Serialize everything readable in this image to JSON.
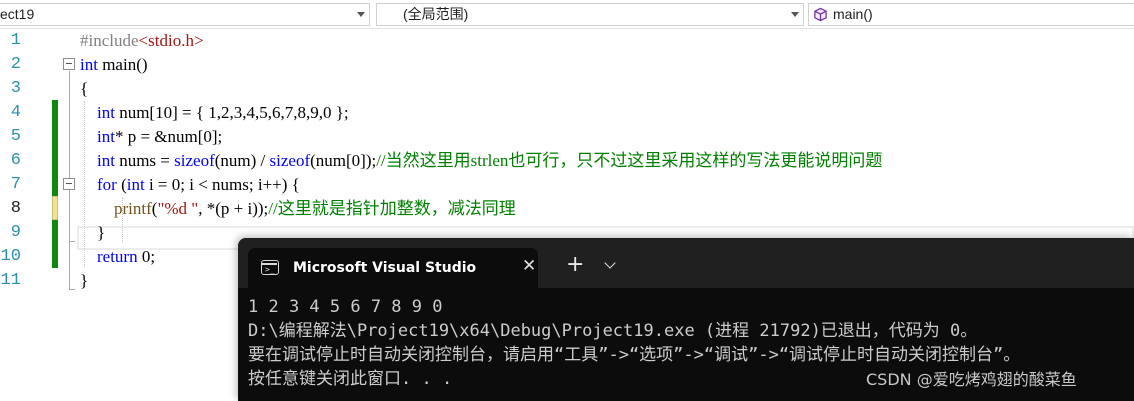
{
  "navbar": {
    "project": "ect19",
    "scope": "(全局范围)",
    "member": "main()",
    "member_icon": "cube-icon"
  },
  "editor": {
    "line_numbers": [
      "1",
      "2",
      "3",
      "4",
      "5",
      "6",
      "7",
      "8",
      "9",
      "10",
      "11"
    ],
    "current_line": "8",
    "lines": [
      [
        {
          "t": "#include",
          "c": "pp"
        },
        {
          "t": "<stdio.h>",
          "c": "str"
        }
      ],
      [
        {
          "t": "int",
          "c": "kw"
        },
        {
          "t": " main()",
          "c": ""
        }
      ],
      [
        {
          "t": "{",
          "c": ""
        }
      ],
      [
        {
          "t": "    ",
          "c": ""
        },
        {
          "t": "int",
          "c": "kw"
        },
        {
          "t": " num[10] = { 1,2,3,4,5,6,7,8,9,0 };",
          "c": ""
        }
      ],
      [
        {
          "t": "    ",
          "c": ""
        },
        {
          "t": "int",
          "c": "kw"
        },
        {
          "t": "* p = &num[0];",
          "c": ""
        }
      ],
      [
        {
          "t": "    ",
          "c": ""
        },
        {
          "t": "int",
          "c": "kw"
        },
        {
          "t": " nums = ",
          "c": ""
        },
        {
          "t": "sizeof",
          "c": "kw"
        },
        {
          "t": "(num) / ",
          "c": ""
        },
        {
          "t": "sizeof",
          "c": "kw"
        },
        {
          "t": "(num[0]);",
          "c": ""
        },
        {
          "t": "//当然这里用strlen也可行，只不过这里采用这样的写法更能说明问题",
          "c": "cm"
        }
      ],
      [
        {
          "t": "    ",
          "c": ""
        },
        {
          "t": "for",
          "c": "kw"
        },
        {
          "t": " (",
          "c": ""
        },
        {
          "t": "int",
          "c": "kw"
        },
        {
          "t": " i = 0; i < nums; i++) {",
          "c": ""
        }
      ],
      [
        {
          "t": "        ",
          "c": ""
        },
        {
          "t": "printf",
          "c": "fn"
        },
        {
          "t": "(",
          "c": ""
        },
        {
          "t": "\"%d \"",
          "c": "str"
        },
        {
          "t": ", *(p + i));",
          "c": ""
        },
        {
          "t": "//这里就是指针加整数，减法同理",
          "c": "cm"
        }
      ],
      [
        {
          "t": "    }",
          "c": ""
        }
      ],
      [
        {
          "t": "    ",
          "c": ""
        },
        {
          "t": "return",
          "c": "kw"
        },
        {
          "t": " 0;",
          "c": ""
        }
      ],
      [
        {
          "t": "}",
          "c": ""
        }
      ]
    ]
  },
  "terminal": {
    "tab_title": "Microsoft Visual Studio 调试控制台",
    "close_glyph": "✕",
    "new_tab_glyph": "+",
    "output": [
      "1 2 3 4 5 6 7 8 9 0",
      "D:\\编程解法\\Project19\\x64\\Debug\\Project19.exe (进程 21792)已退出，代码为 0。",
      "要在调试停止时自动关闭控制台，请启用“工具”->“选项”->“调试”->“调试停止时自动关闭控制台”。",
      "按任意键关闭此窗口. . ."
    ]
  },
  "watermark": "CSDN @爱吃烤鸡翅的酸菜鱼",
  "colors": {
    "keyword": "#0000ff",
    "string": "#a31515",
    "comment": "#008000",
    "preprocessor": "#808080",
    "line_number": "#2b91af",
    "change_saved": "#108810",
    "terminal_bg": "#0c0c0c"
  }
}
